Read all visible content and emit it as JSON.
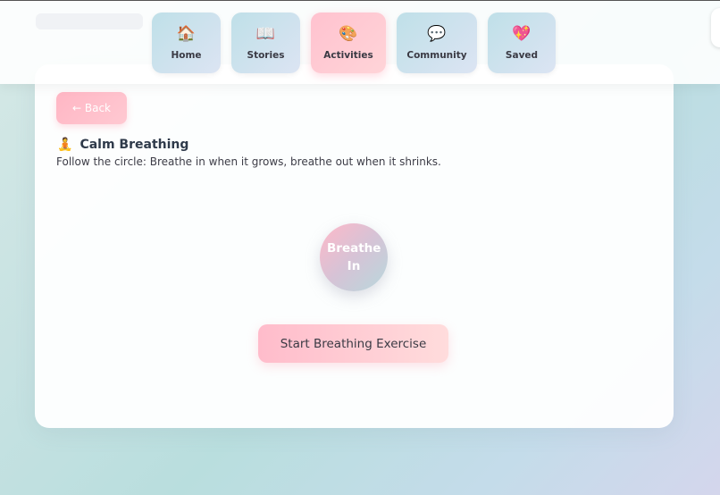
{
  "nav": {
    "items": [
      {
        "label": "Home",
        "icon": "🏠",
        "icon_name": "house-icon"
      },
      {
        "label": "Stories",
        "icon": "📖",
        "icon_name": "book-icon"
      },
      {
        "label": "Activities",
        "icon": "🎨",
        "icon_name": "palette-icon",
        "active": true
      },
      {
        "label": "Community",
        "icon": "💬",
        "icon_name": "speech-bubble-icon"
      },
      {
        "label": "Saved",
        "icon": "💖",
        "icon_name": "heart-icon"
      }
    ]
  },
  "main": {
    "back_label": "← Back",
    "title_icon": "🧘",
    "title": "Calm Breathing",
    "instruction": "Follow the circle: Breathe in when it grows, breathe out when it shrinks.",
    "circle_text": "Breathe In",
    "start_label": "Start Breathing Exercise"
  },
  "colors": {
    "accent_pink": "#ffb6c4",
    "accent_teal": "#bfe0e8",
    "background_start": "#d6e9e6",
    "background_end": "#d4d6ec"
  }
}
